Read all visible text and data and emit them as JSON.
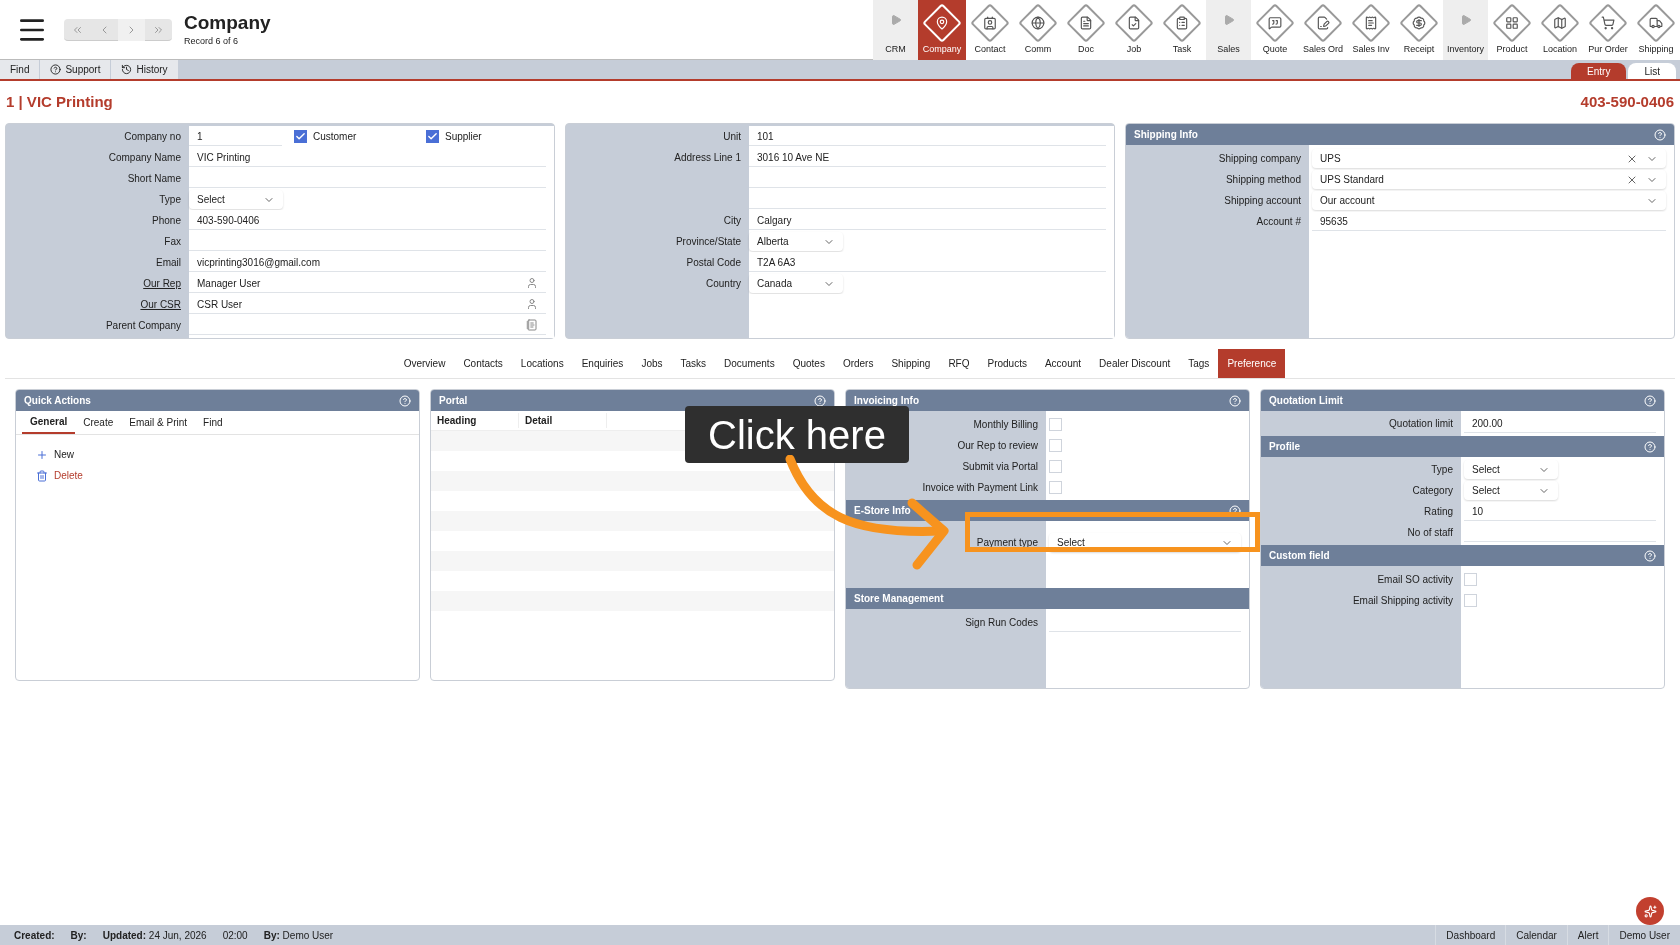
{
  "header": {
    "title": "Company",
    "subtitle": "Record 6 of 6"
  },
  "modules": [
    {
      "label": "CRM",
      "kind": "group",
      "selected": false
    },
    {
      "label": "Company",
      "kind": "module",
      "selected": true
    },
    {
      "label": "Contact",
      "kind": "module",
      "selected": false
    },
    {
      "label": "Comm",
      "kind": "module",
      "selected": false
    },
    {
      "label": "Doc",
      "kind": "module",
      "selected": false
    },
    {
      "label": "Job",
      "kind": "module",
      "selected": false
    },
    {
      "label": "Task",
      "kind": "module",
      "selected": false
    },
    {
      "label": "Sales",
      "kind": "group",
      "selected": false
    },
    {
      "label": "Quote",
      "kind": "module",
      "selected": false
    },
    {
      "label": "Sales Ord",
      "kind": "module",
      "selected": false
    },
    {
      "label": "Sales Inv",
      "kind": "module",
      "selected": false
    },
    {
      "label": "Receipt",
      "kind": "module",
      "selected": false
    },
    {
      "label": "Inventory",
      "kind": "group",
      "selected": false
    },
    {
      "label": "Product",
      "kind": "module",
      "selected": false
    },
    {
      "label": "Location",
      "kind": "module",
      "selected": false
    },
    {
      "label": "Pur Order",
      "kind": "module",
      "selected": false
    },
    {
      "label": "Shipping",
      "kind": "module",
      "selected": false
    }
  ],
  "toolbar": [
    {
      "label": "Find",
      "kind": "plain"
    },
    {
      "label": "Support",
      "kind": "help"
    },
    {
      "label": "History",
      "kind": "history"
    }
  ],
  "view_tabs": [
    {
      "label": "Entry",
      "selected": true
    },
    {
      "label": "List",
      "selected": false
    }
  ],
  "record": {
    "title": "1 | VIC Printing",
    "phone": "403-590-0406"
  },
  "company_form": [
    {
      "label": "Company no",
      "value": "1",
      "kind": "text",
      "link": false,
      "checks": [
        {
          "label": "Customer",
          "checked": true
        },
        {
          "label": "Supplier",
          "checked": true
        }
      ]
    },
    {
      "label": "Company Name",
      "value": "VIC Printing",
      "kind": "text",
      "link": false
    },
    {
      "label": "Short Name",
      "kind": "text",
      "link": false
    },
    {
      "label": "Type",
      "value": "Select",
      "kind": "select",
      "link": false
    },
    {
      "label": "Phone",
      "value": "403-590-0406",
      "kind": "text",
      "link": false
    },
    {
      "label": "Fax",
      "kind": "text",
      "link": false
    },
    {
      "label": "Email",
      "value": "vicprinting3016@gmail.com",
      "kind": "text",
      "link": false
    },
    {
      "label": "Our Rep",
      "value": "Manager User",
      "kind": "person",
      "link": true
    },
    {
      "label": "Our CSR",
      "value": "CSR User",
      "kind": "person",
      "link": true
    },
    {
      "label": "Parent Company",
      "kind": "picker",
      "link": false
    }
  ],
  "address_form": [
    {
      "label": "Unit",
      "value": "101",
      "kind": "text"
    },
    {
      "label": "Address Line 1",
      "value": "3016 10 Ave NE",
      "kind": "text"
    },
    {
      "kind": "text"
    },
    {
      "kind": "text"
    },
    {
      "label": "City",
      "value": "Calgary",
      "kind": "text"
    },
    {
      "label": "Province/State",
      "value": "Alberta",
      "kind": "select"
    },
    {
      "label": "Postal Code",
      "value": "T2A 6A3",
      "kind": "text"
    },
    {
      "label": "Country",
      "value": "Canada",
      "kind": "select"
    }
  ],
  "shipping_info": {
    "title": "Shipping Info",
    "fields": [
      {
        "label": "Shipping company",
        "value": "UPS",
        "kind": "select",
        "clearable": true
      },
      {
        "label": "Shipping method",
        "value": "UPS Standard",
        "kind": "select",
        "clearable": true
      },
      {
        "label": "Shipping account",
        "value": "Our account",
        "kind": "select",
        "clearable": false
      },
      {
        "label": "Account #",
        "value": "95635",
        "kind": "text"
      }
    ]
  },
  "section_tabs": [
    {
      "label": "Overview",
      "selected": false
    },
    {
      "label": "Contacts",
      "selected": false
    },
    {
      "label": "Locations",
      "selected": false
    },
    {
      "label": "Enquiries",
      "selected": false
    },
    {
      "label": "Jobs",
      "selected": false
    },
    {
      "label": "Tasks",
      "selected": false
    },
    {
      "label": "Documents",
      "selected": false
    },
    {
      "label": "Quotes",
      "selected": false
    },
    {
      "label": "Orders",
      "selected": false
    },
    {
      "label": "Shipping",
      "selected": false
    },
    {
      "label": "RFQ",
      "selected": false
    },
    {
      "label": "Products",
      "selected": false
    },
    {
      "label": "Account",
      "selected": false
    },
    {
      "label": "Dealer Discount",
      "selected": false
    },
    {
      "label": "Tags",
      "selected": false
    },
    {
      "label": "Preference",
      "selected": true
    }
  ],
  "quick_actions": {
    "title": "Quick Actions",
    "tabs": [
      {
        "label": "General",
        "selected": true
      },
      {
        "label": "Create",
        "selected": false
      },
      {
        "label": "Email & Print",
        "selected": false
      },
      {
        "label": "Find",
        "selected": false
      }
    ],
    "actions": [
      {
        "label": "New",
        "kind": "add"
      },
      {
        "label": "Delete",
        "kind": "delete"
      }
    ]
  },
  "portal": {
    "title": "Portal",
    "columns": [
      "Heading",
      "Detail"
    ]
  },
  "invoicing_info": {
    "title": "Invoicing Info",
    "options": [
      {
        "label": "Monthly Billing",
        "checked": false
      },
      {
        "label": "Our Rep to review",
        "checked": false
      },
      {
        "label": "Submit via Portal",
        "checked": false
      },
      {
        "label": "Invoice with Payment Link",
        "checked": false
      }
    ]
  },
  "estore_info": {
    "title": "E-Store Info",
    "fields": [
      {
        "label": "Payment type",
        "value": "Select",
        "kind": "select"
      }
    ]
  },
  "store_management": {
    "title": "Store Management",
    "fields": [
      {
        "label": "Sign Run Codes",
        "kind": "text"
      }
    ]
  },
  "quotation_limit": {
    "title": "Quotation Limit",
    "fields": [
      {
        "label": "Quotation limit",
        "value": "200.00",
        "kind": "text"
      }
    ]
  },
  "profile": {
    "title": "Profile",
    "fields": [
      {
        "label": "Type",
        "value": "Select",
        "kind": "select"
      },
      {
        "label": "Category",
        "value": "Select",
        "kind": "select"
      },
      {
        "label": "Rating",
        "value": "10",
        "kind": "text"
      },
      {
        "label": "No of staff",
        "kind": "text"
      }
    ]
  },
  "custom_field": {
    "title": "Custom field",
    "options": [
      {
        "label": "Email SO activity",
        "checked": false
      },
      {
        "label": "Email Shipping activity",
        "checked": false
      }
    ]
  },
  "callout": {
    "text": "Click here"
  },
  "status_bar": {
    "left": [
      {
        "label": "Created:"
      },
      {
        "label": "By:"
      },
      {
        "label": "Updated:",
        "value": "24 Jun, 2026"
      },
      {
        "value": "02:00"
      },
      {
        "label": "By:",
        "value": "Demo User"
      }
    ],
    "right": [
      "Dashboard",
      "Calendar",
      "Alert",
      "Demo User"
    ]
  }
}
